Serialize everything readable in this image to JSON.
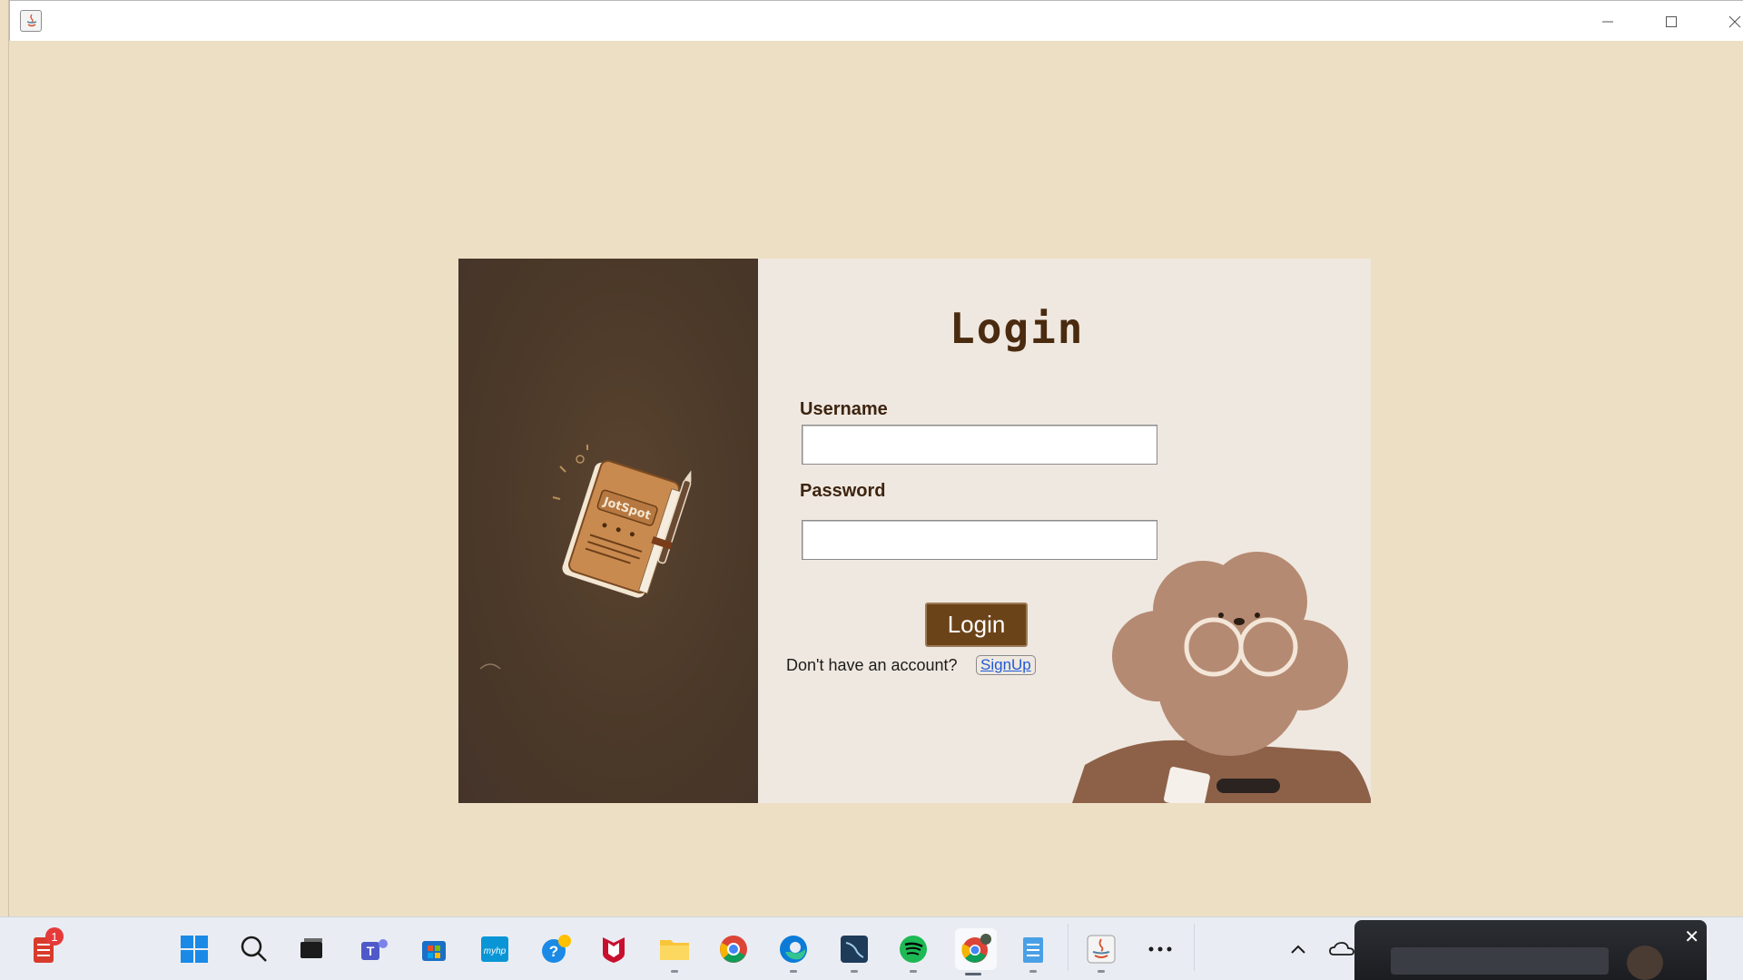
{
  "window": {
    "minimize_icon": "minimize-icon",
    "maximize_icon": "maximize-icon",
    "close_icon": "close-icon"
  },
  "branding": {
    "notebook_text": "JotSpot"
  },
  "login": {
    "title": "Login",
    "username_label": "Username",
    "username_value": "",
    "password_label": "Password",
    "password_value": "",
    "button_label": "Login",
    "no_account_text": "Don't have an account?",
    "signup_link": "SignUp"
  },
  "colors": {
    "background": "#eddfc4",
    "left_panel": "#4a3828",
    "right_panel": "#efe8e0",
    "button": "#6b4318",
    "title": "#4a2b10"
  },
  "taskbar": {
    "notification_badge": "1",
    "items": [
      "notes-app-icon",
      "start-icon",
      "search-icon",
      "task-view-icon",
      "teams-icon",
      "store-icon",
      "myhp-icon",
      "help-icon",
      "mcafee-icon",
      "file-explorer-icon",
      "chrome-icon",
      "edge-icon",
      "mysql-workbench-icon",
      "spotify-icon",
      "chrome-profile-icon",
      "notepad-icon",
      "java-icon",
      "more-icon"
    ],
    "preview_close": "✕"
  }
}
